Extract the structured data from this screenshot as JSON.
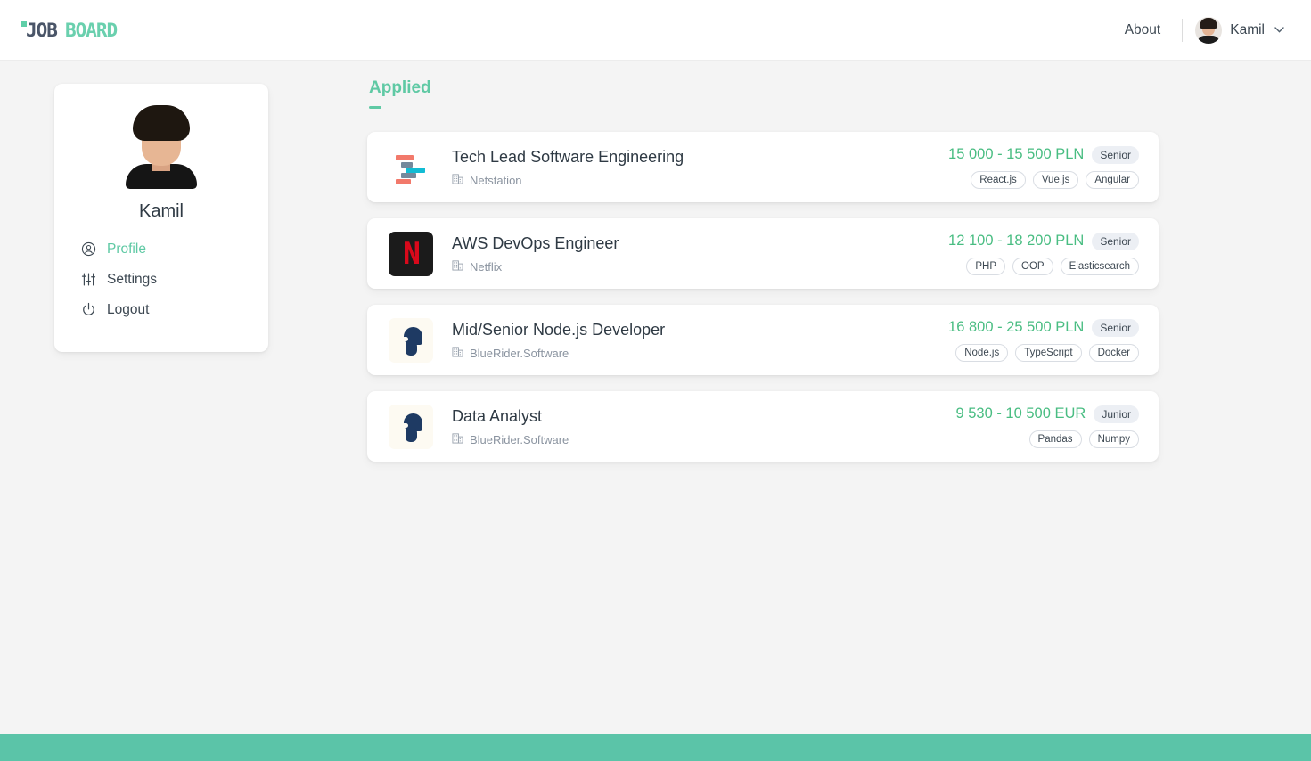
{
  "header": {
    "logo": {
      "part1": "JOB",
      "part2": "BOARD",
      "accent_color": "#6ad0ae",
      "dark_color": "#4a5568"
    },
    "about_label": "About",
    "user_name": "Kamil",
    "chevron": "∨",
    "avatar_icon": "user-avatar"
  },
  "sidebar": {
    "name": "Kamil",
    "items": [
      {
        "label": "Profile",
        "icon": "user-circle-icon",
        "active": true
      },
      {
        "label": "Settings",
        "icon": "sliders-icon",
        "active": false
      },
      {
        "label": "Logout",
        "icon": "power-icon",
        "active": false
      }
    ]
  },
  "main": {
    "section_title": "Applied",
    "accent_color": "#5fc9a4",
    "jobs": [
      {
        "title": "Tech Lead Software Engineering",
        "company": "Netstation",
        "company_icon": "building-icon",
        "logo": "netstation-logo",
        "salary": "15 000 - 15 500 PLN",
        "level": "Senior",
        "tags": [
          "React.js",
          "Vue.js",
          "Angular"
        ]
      },
      {
        "title": "AWS DevOps Engineer",
        "company": "Netflix",
        "company_icon": "building-icon",
        "logo": "netflix-logo",
        "logo_letter": "N",
        "salary": "12 100 - 18 200 PLN",
        "level": "Senior",
        "tags": [
          "PHP",
          "OOP",
          "Elasticsearch"
        ]
      },
      {
        "title": "Mid/Senior Node.js Developer",
        "company": "BlueRider.Software",
        "company_icon": "building-icon",
        "logo": "bluerider-logo",
        "salary": "16 800 - 25 500 PLN",
        "level": "Senior",
        "tags": [
          "Node.js",
          "TypeScript",
          "Docker"
        ]
      },
      {
        "title": "Data Analyst",
        "company": "BlueRider.Software",
        "company_icon": "building-icon",
        "logo": "bluerider-logo",
        "salary": "9 530 - 10 500 EUR",
        "level": "Junior",
        "tags": [
          "Pandas",
          "Numpy"
        ]
      }
    ]
  },
  "footer": {
    "color": "#5bc4a8"
  }
}
